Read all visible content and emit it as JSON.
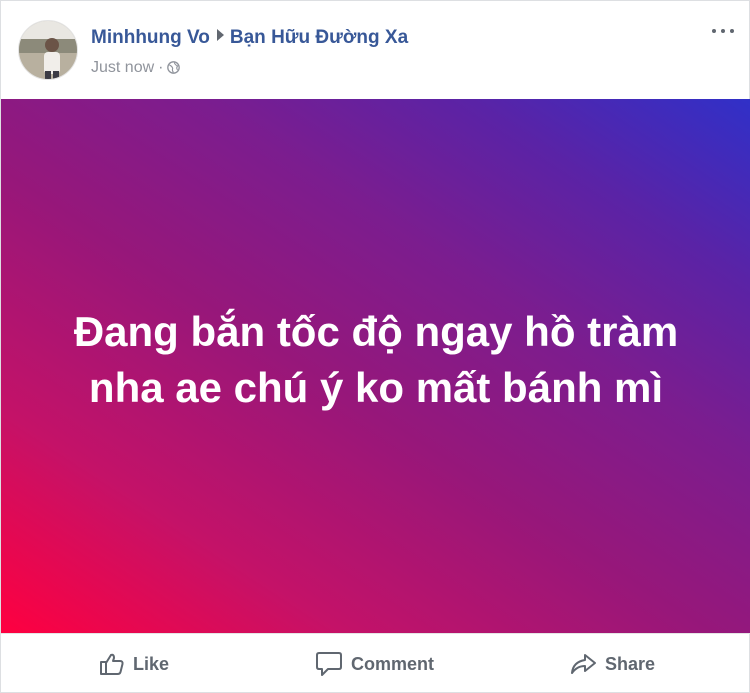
{
  "post": {
    "author": "Minhhung Vo",
    "group": "Bạn Hữu Đường Xa",
    "timestamp": "Just now",
    "separator": "·",
    "privacy_icon": "globe-icon",
    "more_icon": "more-options-icon"
  },
  "card": {
    "text": "Đang bắn tốc độ ngay hồ tràm nha ae chú ý ko mất bánh mì",
    "gradient_colors": [
      "#ff0040",
      "#97177a",
      "#3030c8"
    ],
    "text_color": "#ffffff"
  },
  "actions": {
    "like_label": "Like",
    "comment_label": "Comment",
    "share_label": "Share"
  },
  "colors": {
    "name_link": "#385898",
    "meta": "#90949c",
    "action_text": "#606770"
  }
}
